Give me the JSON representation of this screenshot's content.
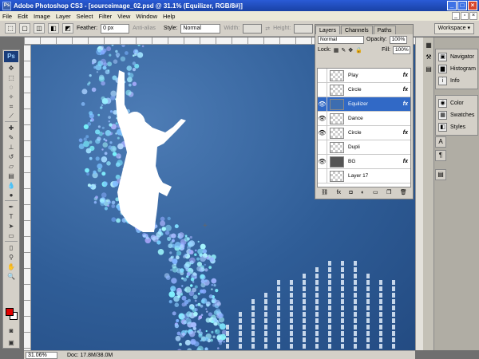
{
  "window": {
    "title": "Adobe Photoshop CS3 - [sourceimage_02.psd @ 31.1% (Equilizer, RGB/8#)]",
    "app_icon": "Ps"
  },
  "menu": [
    "File",
    "Edit",
    "Image",
    "Layer",
    "Select",
    "Filter",
    "View",
    "Window",
    "Help"
  ],
  "options": {
    "feather_label": "Feather:",
    "feather_value": "0 px",
    "antialias_label": "Anti-alias",
    "style_label": "Style:",
    "style_value": "Normal",
    "width_label": "Width:",
    "height_label": "Height:",
    "workspace_label": "Workspace ▾"
  },
  "toolbox": {
    "logo": "Ps"
  },
  "layers_panel": {
    "tabs": [
      "Layers",
      "Channels",
      "Paths"
    ],
    "blend_mode": "Normal",
    "opacity_label": "Opacity:",
    "opacity_value": "100%",
    "lock_label": "Lock:",
    "fill_label": "Fill:",
    "fill_value": "100%",
    "layers": [
      {
        "name": "Play",
        "fx": "fx",
        "visible": false,
        "selected": false
      },
      {
        "name": "Circle",
        "fx": "fx",
        "visible": false,
        "selected": false
      },
      {
        "name": "Equilizer",
        "fx": "fx",
        "visible": true,
        "selected": true
      },
      {
        "name": "Dance",
        "fx": "",
        "visible": true,
        "selected": false
      },
      {
        "name": "Circle",
        "fx": "fx",
        "visible": true,
        "selected": false
      },
      {
        "name": "Dupli",
        "fx": "",
        "visible": false,
        "selected": false
      },
      {
        "name": "BG",
        "fx": "fx",
        "visible": true,
        "selected": false
      },
      {
        "name": "Layer 17",
        "fx": "",
        "visible": false,
        "selected": false
      }
    ]
  },
  "dock": {
    "group1": [
      "Navigator",
      "Histogram",
      "Info"
    ],
    "group2": [
      "Color",
      "Swatches",
      "Styles"
    ]
  },
  "status": {
    "zoom": "31.06%",
    "doc": "Doc: 17.8M/38.0M"
  },
  "colors": {
    "foreground": "#e00000",
    "background": "#ffffff",
    "selection": "#3169c6"
  },
  "equalizer_levels": [
    0.28,
    0.4,
    0.52,
    0.62,
    0.7,
    0.76,
    0.82,
    0.88,
    0.94,
    0.94,
    0.9,
    0.82,
    0.76,
    0.7
  ]
}
